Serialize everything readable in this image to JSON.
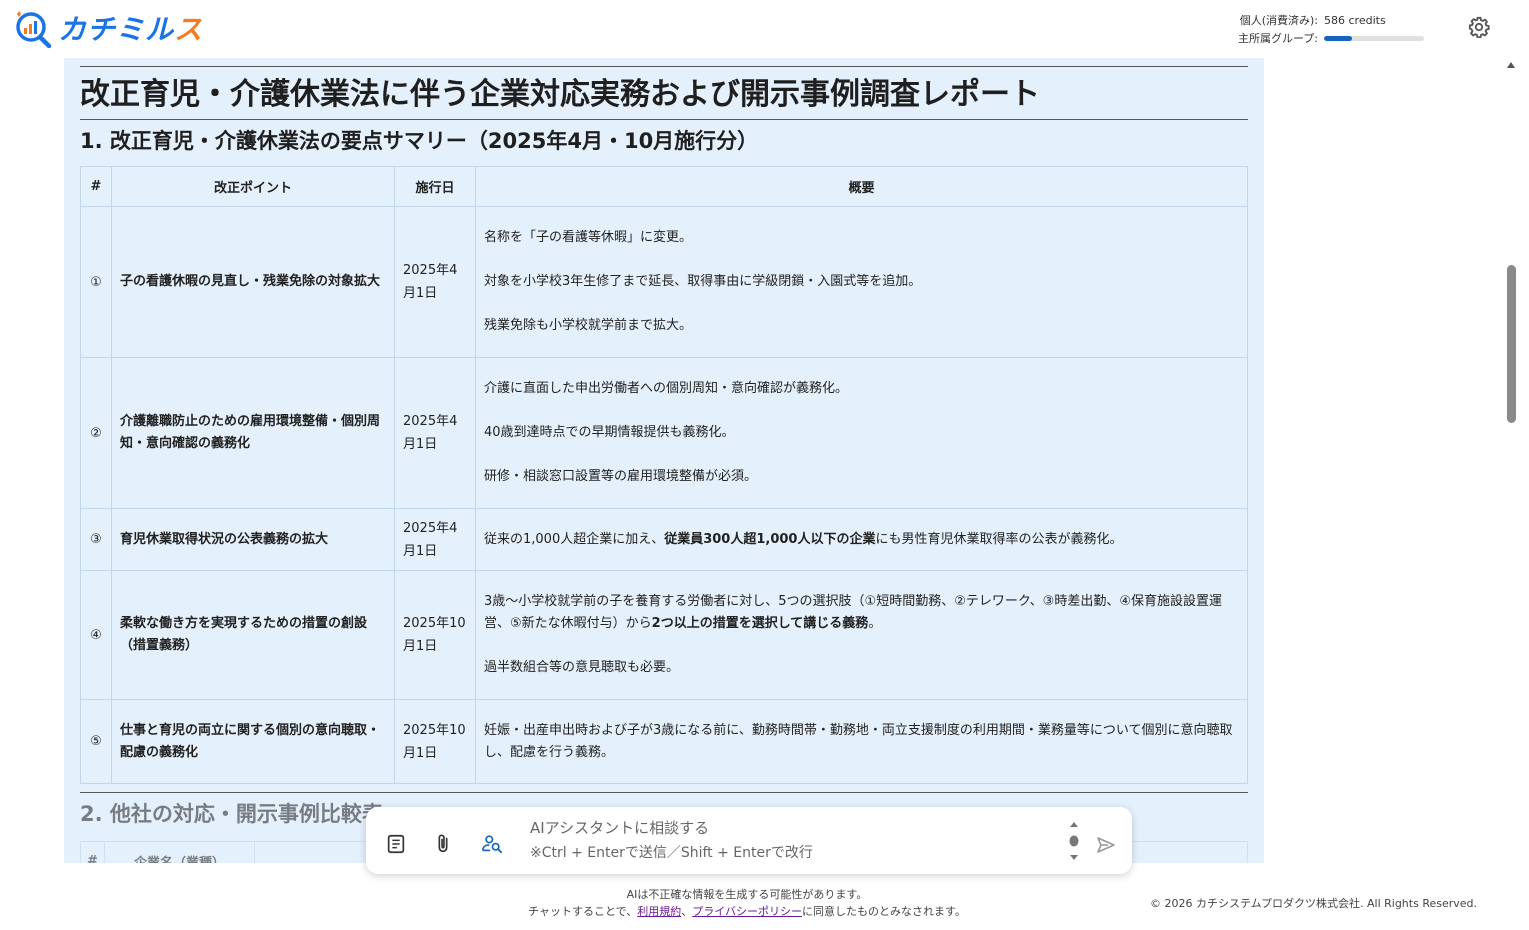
{
  "app": {
    "logo_text_main": "カチミル",
    "logo_text_accent": "ス"
  },
  "credits": {
    "personal_label": "個人(消費済み):",
    "personal_value": "586 credits",
    "group_label": "主所属グループ:",
    "group_progress_percent": 28
  },
  "doc": {
    "title": "改正育児・介護休業法に伴う企業対応実務および開示事例調査レポート",
    "section1_heading": "1. 改正育児・介護休業法の要点サマリー（2025年4月・10月施行分）",
    "table1": {
      "headers": [
        "#",
        "改正ポイント",
        "施行日",
        "概要"
      ],
      "rows": [
        {
          "num": "①",
          "point": "子の看護休暇の見直し・残業免除の対象拡大",
          "date": "2025年4月1日",
          "summary": [
            "名称を「子の看護等休暇」に変更。",
            "対象を小学校3年生修了まで延長、取得事由に学級閉鎖・入園式等を追加。",
            "残業免除も小学校就学前まで拡大。"
          ]
        },
        {
          "num": "②",
          "point": "介護離職防止のための雇用環境整備・個別周知・意向確認の義務化",
          "date": "2025年4月1日",
          "summary": [
            "介護に直面した申出労働者への個別周知・意向確認が義務化。",
            "40歳到達時点での早期情報提供も義務化。",
            "研修・相談窓口設置等の雇用環境整備が必須。"
          ]
        },
        {
          "num": "③",
          "point": "育児休業取得状況の公表義務の拡大",
          "date": "2025年4月1日",
          "summary_pre": "従来の1,000人超企業に加え、",
          "summary_bold": "従業員300人超1,000人以下の企業",
          "summary_post": "にも男性育児休業取得率の公表が義務化。"
        },
        {
          "num": "④",
          "point": "柔軟な働き方を実現するための措置の創設（措置義務）",
          "date": "2025年10月1日",
          "summary_pre": "3歳〜小学校就学前の子を養育する労働者に対し、5つの選択肢（①短時間勤務、②テレワーク、③時差出勤、④保育施設設置運営、⑤新たな休暇付与）から",
          "summary_bold": "2つ以上の措置を選択して講じる義務",
          "summary_post": "。",
          "summary_extra": "過半数組合等の意見聴取も必要。"
        },
        {
          "num": "⑤",
          "point": "仕事と育児の両立に関する個別の意向聴取・配慮の義務化",
          "date": "2025年10月1日",
          "summary": [
            "妊娠・出産申出時および子が3歳になる前に、勤務時間帯・勤務地・両立支援制度の利用期間・業務量等について個別に意向聴取し、配慮を行う義務。"
          ]
        }
      ]
    },
    "section2_heading": "2. 他社の対応・開示事例比較表",
    "table2_headers": [
      "#",
      "企業名（業種）"
    ]
  },
  "chat": {
    "placeholder_line1": "AIアシスタントに相談する",
    "placeholder_line2": "※Ctrl + Enterで送信／Shift + Enterで改行"
  },
  "footer": {
    "disclaimer": "AIは不正確な情報を生成する可能性があります。",
    "consent_pre": "チャットすることで、",
    "terms_link": "利用規約",
    "sep": "、",
    "privacy_link": "プライバシーポリシー",
    "consent_post": "に同意したものとみなされます。",
    "copyright": "© 2026 カチシステムプロダクツ株式会社. All Rights Reserved."
  },
  "colors": {
    "brand_blue": "#1a73e8",
    "brand_orange": "#f47b20",
    "doc_bg": "#e4f0fc",
    "progress": "#1565c0"
  }
}
